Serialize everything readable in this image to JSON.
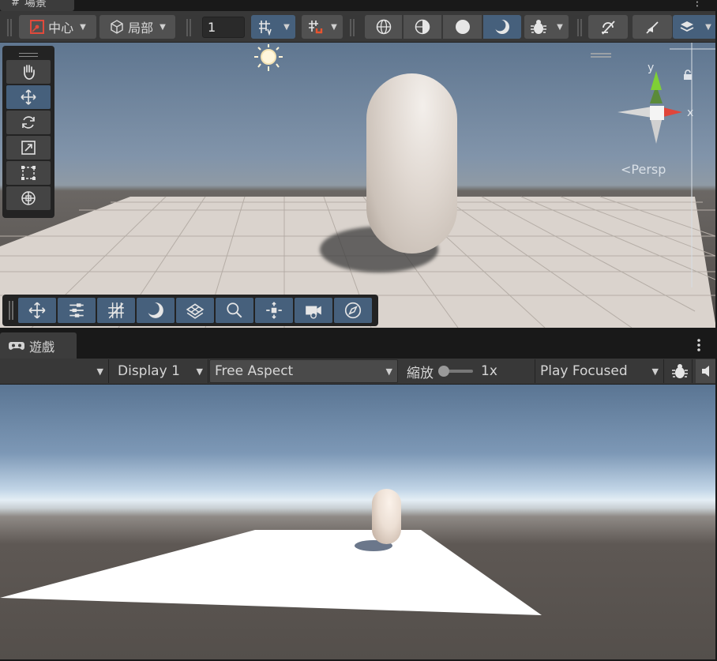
{
  "scene": {
    "tab_label": "場景",
    "toolbar": {
      "pivot_label": "中心",
      "handle_rotation_label": "局部",
      "grid_size_value": "1"
    },
    "camera_mode_label": "<Persp",
    "tools": [
      "hand-tool",
      "move-tool",
      "rotate-tool",
      "scale-tool",
      "rect-tool",
      "transform-tool"
    ],
    "overlays": [
      "move-overlay",
      "settings-overlay",
      "grid-overlay",
      "shading-overlay",
      "navmesh-overlay",
      "search-overlay",
      "component-overlay",
      "camera-overlay",
      "compass-overlay"
    ]
  },
  "game": {
    "tab_label": "遊戲",
    "display_label": "Display 1",
    "aspect_label": "Free Aspect",
    "zoom_label": "縮放",
    "zoom_value": "1x",
    "play_mode_label": "Play Focused"
  },
  "gizmo": {
    "y_label": "y",
    "x_label": "x"
  },
  "colors": {
    "accent": "#46607c",
    "toolbar_bg": "#383838",
    "button_bg": "#515151",
    "gizmo_x": "#e0453a",
    "gizmo_y": "#7fd035"
  }
}
